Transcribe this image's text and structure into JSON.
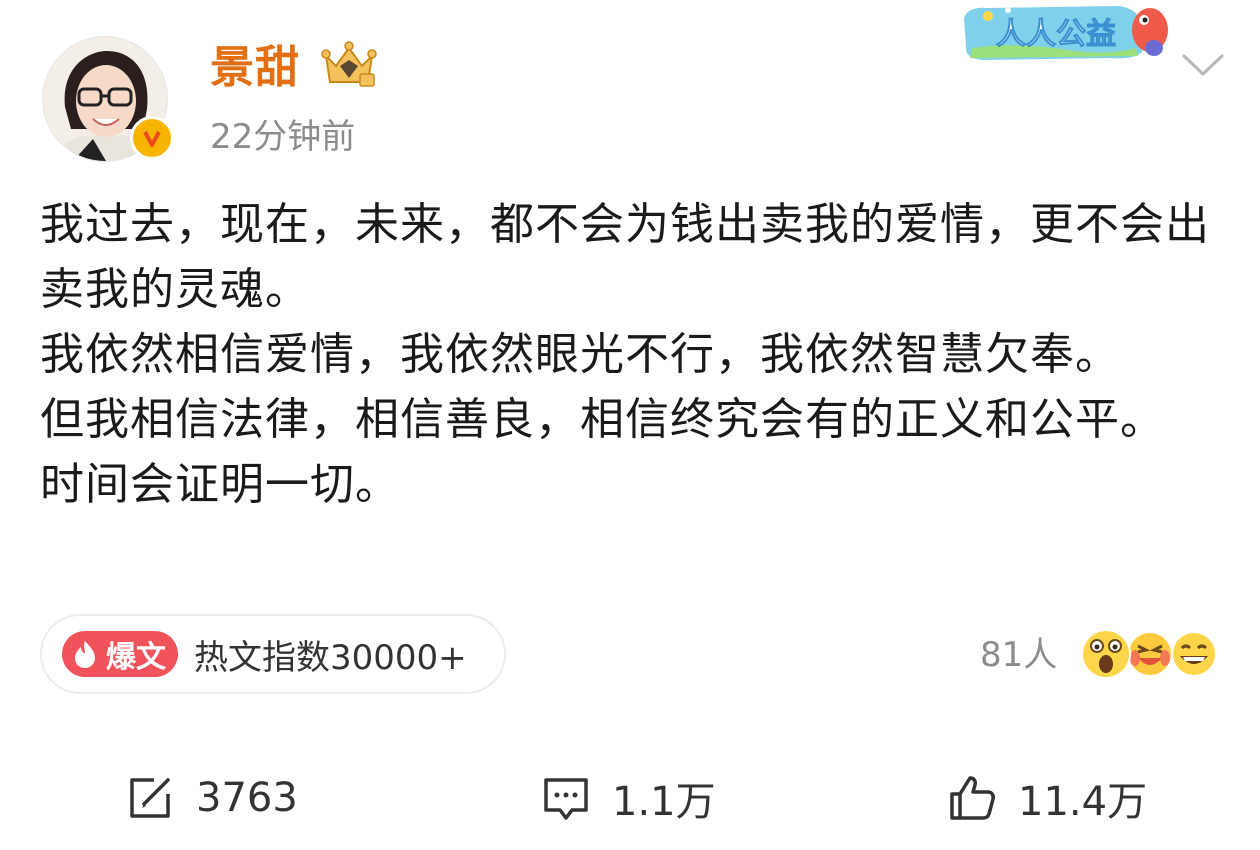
{
  "user": {
    "name": "景甜",
    "time": "22分钟前"
  },
  "banner": {
    "label": "人人公益"
  },
  "post": {
    "paragraphs": [
      "我过去，现在，未来，都不会为钱出卖我的爱情，更不会出卖我的灵魂。",
      "我依然相信爱情，我依然眼光不行，我依然智慧欠奉。",
      "但我相信法律，相信善良，相信终究会有的正义和公平。",
      "时间会证明一切。"
    ]
  },
  "hot": {
    "badge": "爆文",
    "text": "热文指数30000+"
  },
  "reactions": {
    "count": "81人",
    "emojis": [
      "shocked-emoji-icon",
      "crying-laugh-emoji-icon",
      "grin-emoji-icon"
    ]
  },
  "actions": {
    "repost": "3763",
    "comment": "1.1万",
    "like": "11.4万"
  },
  "colors": {
    "name": "#e36f13",
    "muted": "#8c8c8c",
    "hot_badge": "#f0545a",
    "verified": "#f7b500"
  }
}
